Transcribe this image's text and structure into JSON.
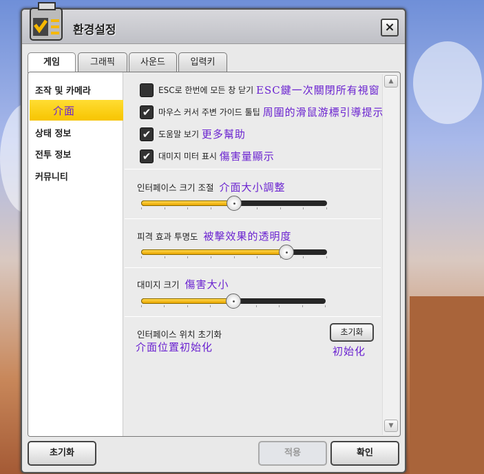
{
  "window": {
    "title": "환경설정",
    "close_icon": "×"
  },
  "tabs": [
    {
      "label": "게임",
      "active": true
    },
    {
      "label": "그래픽"
    },
    {
      "label": "사운드"
    },
    {
      "label": "입력키"
    }
  ],
  "sidebar": {
    "items": [
      {
        "label": "조작 및 카메라"
      },
      {
        "label": "介面",
        "selected": true
      },
      {
        "label": "상태 정보"
      },
      {
        "label": "전투 정보"
      },
      {
        "label": "커뮤니티"
      }
    ]
  },
  "options": [
    {
      "label": "ESC로 한번에 모든 창 닫기",
      "note": "ESC鍵一次關閉所有視窗",
      "checked": false
    },
    {
      "label": "마우스 커서 주변 가이드 툴팁",
      "note": "周圍的滑鼠游標引導提示",
      "checked": true
    },
    {
      "label": "도움말 보기",
      "note": "更多幫助",
      "checked": true
    },
    {
      "label": "대미지 미터 표시",
      "note": "傷害量顯示",
      "checked": true
    }
  ],
  "sliders": [
    {
      "label": "인터페이스 크기 조절",
      "note": "介面大小調整",
      "value": 0.5
    },
    {
      "label": "피격 효과 투명도",
      "note": "被擊效果的透明度",
      "value": 0.78
    },
    {
      "label": "대미지 크기",
      "note": "傷害大小",
      "value": 0.5
    }
  ],
  "position_reset": {
    "label": "인터페이스 위치 초기화",
    "note": "介面位置初始化",
    "button": "초기화",
    "button_note": "初始化"
  },
  "footer": {
    "reset": "초기화",
    "apply": "적용",
    "ok": "확인"
  },
  "colors": {
    "accent": "#f7c400",
    "note": "#6a22d0"
  }
}
